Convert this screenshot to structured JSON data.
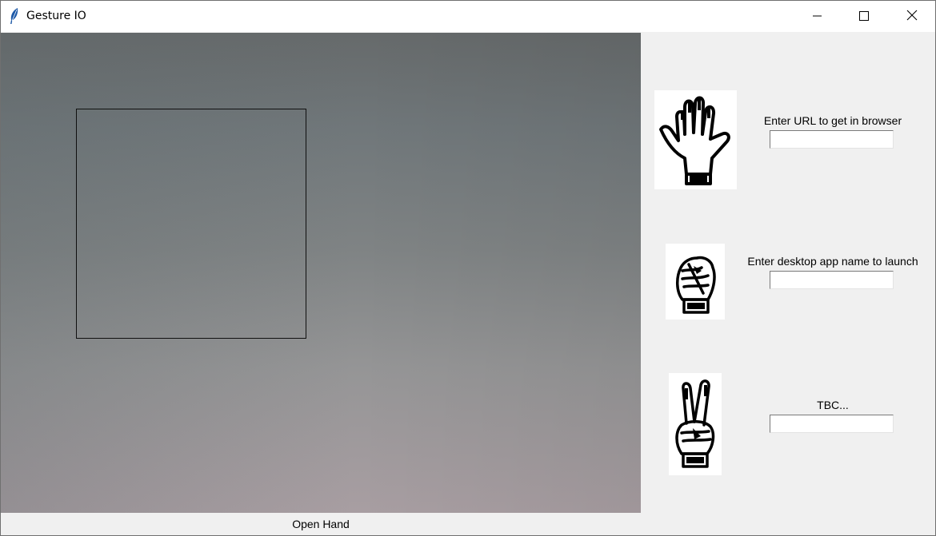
{
  "window": {
    "title": "Gesture IO",
    "icon": "feather-icon",
    "controls": [
      "minimize-icon",
      "maximize-icon",
      "close-icon"
    ]
  },
  "gestures": [
    {
      "icon": "open-hand-icon",
      "label": "Enter URL to get in browser",
      "value": ""
    },
    {
      "icon": "fist-icon",
      "label": "Enter desktop app name to launch",
      "value": ""
    },
    {
      "icon": "peace-sign-icon",
      "label": "TBC...",
      "value": ""
    }
  ],
  "status": {
    "detected_gesture": "Open Hand"
  }
}
